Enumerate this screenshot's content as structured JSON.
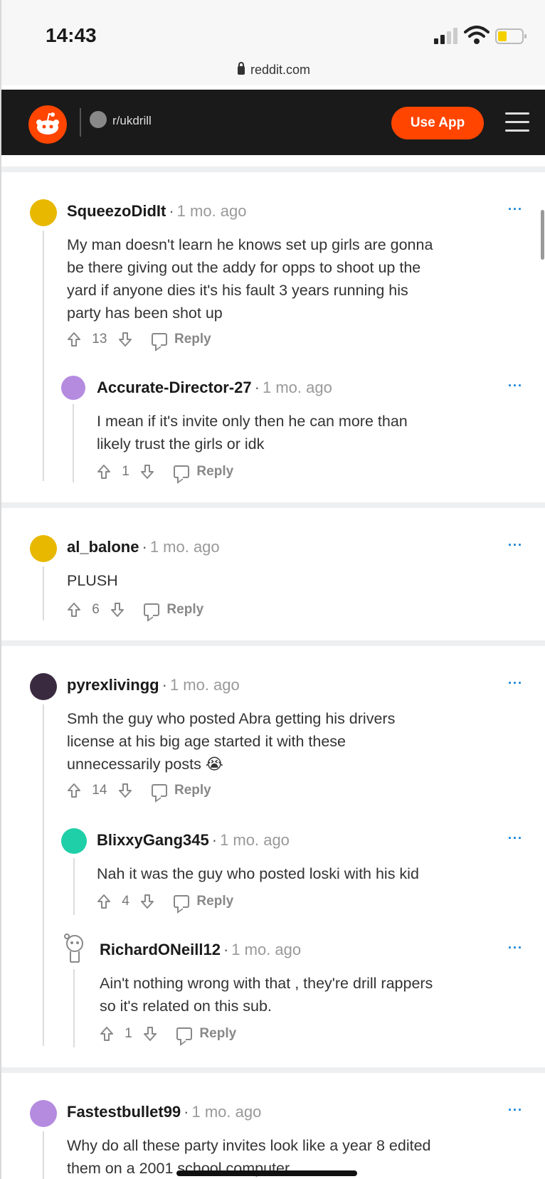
{
  "status_bar": {
    "time": "14:43"
  },
  "browser": {
    "url": "reddit.com"
  },
  "header": {
    "subreddit": "r/ukdrill",
    "use_app_label": "Use App"
  },
  "colors": {
    "accent": "#ff4500",
    "header_bg": "#1a1a1b",
    "link": "#0079d3"
  },
  "comments": [
    {
      "user": "SqueezoDidIt",
      "time": "1 mo. ago",
      "avatar_color": "#e8b800",
      "lines": [
        "My man doesn't learn he knows set up girls are gonna",
        "be there giving out the addy for opps to shoot up the",
        "yard if anyone dies it's his fault 3 years running his",
        "party has been shot up"
      ],
      "votes": "13",
      "reply_label": "Reply"
    },
    {
      "user": "Accurate-Director-27",
      "time": "1 mo. ago",
      "avatar_color": "#b58be0",
      "lines": [
        "I mean if it's invite only then he can more than",
        "likely trust the girls or idk"
      ],
      "votes": "1",
      "reply_label": "Reply"
    },
    {
      "user": "al_balone",
      "time": "1 mo. ago",
      "avatar_color": "#e8b800",
      "lines": [
        "PLUSH"
      ],
      "votes": "6",
      "reply_label": "Reply"
    },
    {
      "user": "pyrexlivingg",
      "time": "1 mo. ago",
      "avatar_color": "#3a2a40",
      "lines": [
        "Smh the guy who posted Abra getting his drivers",
        "license at his big age started it with these",
        "unnecessarily posts 😭"
      ],
      "votes": "14",
      "reply_label": "Reply"
    },
    {
      "user": "BlixxyGang345",
      "time": "1 mo. ago",
      "avatar_color": "#1fcfa8",
      "lines": [
        "Nah it was the guy who posted loski with his kid"
      ],
      "votes": "4",
      "reply_label": "Reply"
    },
    {
      "user": "RichardONeill12",
      "time": "1 mo. ago",
      "avatar_color": "#ffffff",
      "lines": [
        "Ain't nothing wrong with that , they're drill rappers",
        "so it's related on this sub."
      ],
      "votes": "1",
      "reply_label": "Reply"
    },
    {
      "user": "Fastestbullet99",
      "time": "1 mo. ago",
      "avatar_color": "#b58be0",
      "lines": [
        "Why do all these party invites look like a year 8 edited",
        "them on a 2001 school computer"
      ]
    }
  ]
}
